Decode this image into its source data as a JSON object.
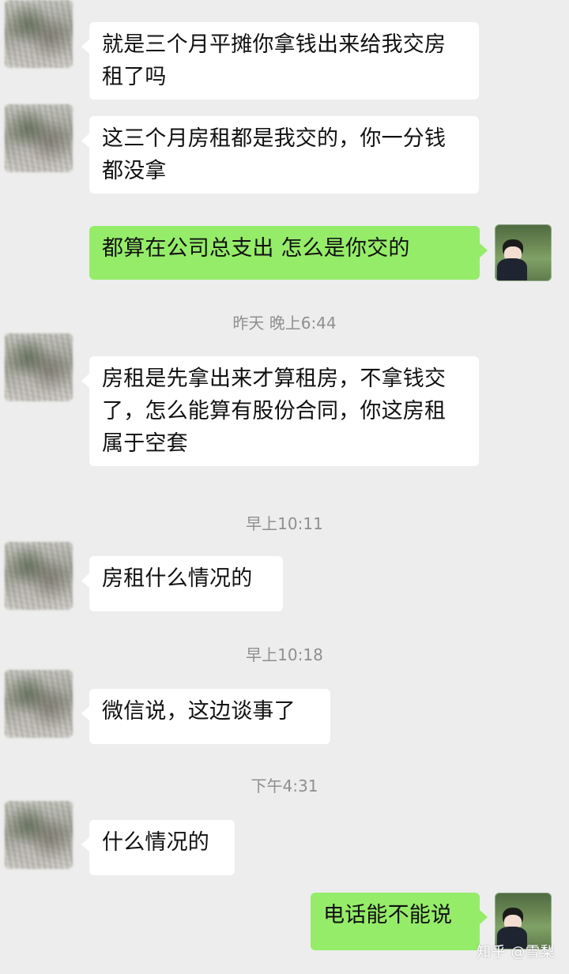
{
  "chat": {
    "messages": [
      {
        "side": "left",
        "text": "就是三个月平摊你拿钱出来给我交房租了吗"
      },
      {
        "side": "left",
        "text": "这三个月房租都是我交的，你一分钱都没拿"
      },
      {
        "side": "right",
        "text": "都算在公司总支出 怎么是你交的"
      },
      {
        "side": "left",
        "text": "房租是先拿出来才算租房，不拿钱交了，怎么能算有股份合同，你这房租属于空套"
      },
      {
        "side": "left",
        "text": "房租什么情况的"
      },
      {
        "side": "left",
        "text": "微信说，这边谈事了"
      },
      {
        "side": "left",
        "text": "什么情况的"
      },
      {
        "side": "right",
        "text": "电话能不能说"
      }
    ],
    "timestamps": [
      "昨天 晚上6:44",
      "早上10:11",
      "早上10:18",
      "下午4:31"
    ]
  },
  "watermark": {
    "text": "知乎 @雪梨"
  },
  "colors": {
    "background": "#ededed",
    "incoming_bubble": "#ffffff",
    "outgoing_bubble": "#95ec69",
    "timestamp_text": "#8f8f8f"
  }
}
